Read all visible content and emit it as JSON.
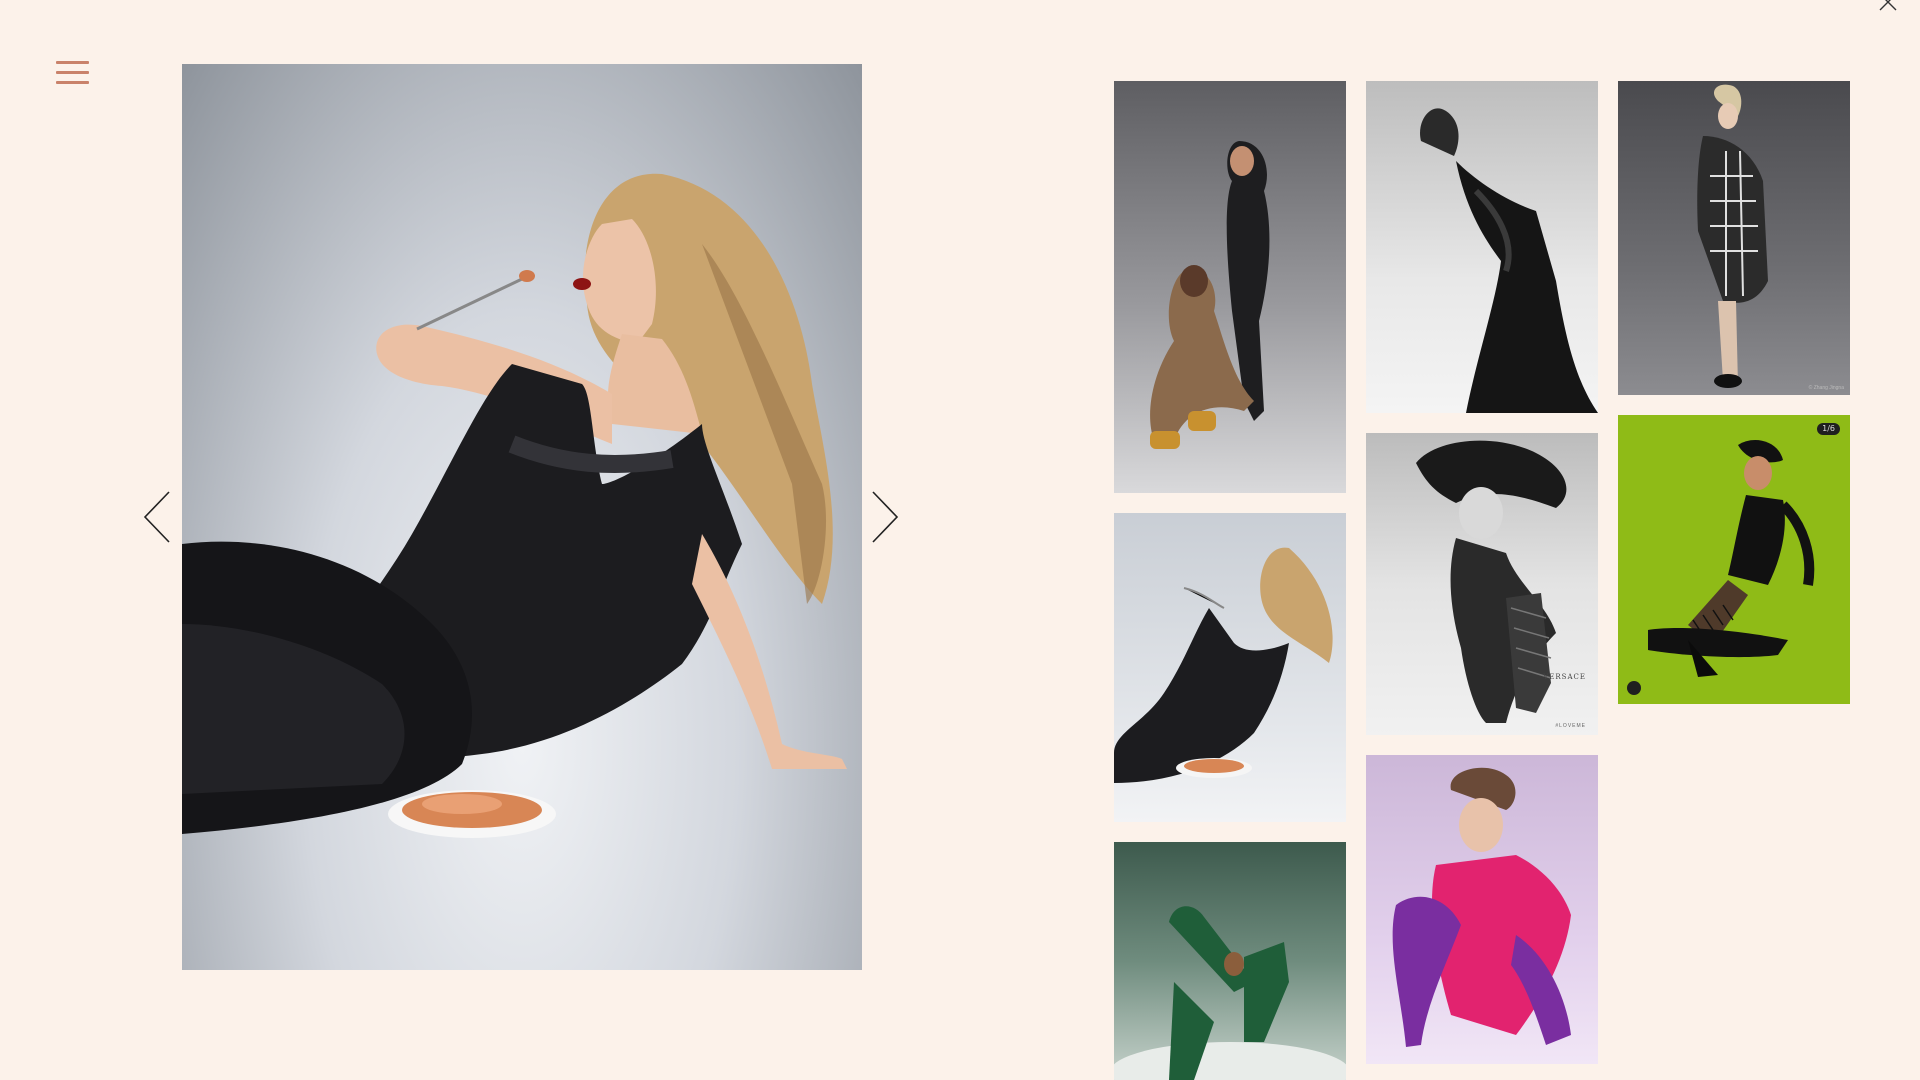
{
  "menu": {
    "icon": "hamburger-menu-icon",
    "color": "#c9826a"
  },
  "close": {
    "icon": "close-icon"
  },
  "lightbox": {
    "current_photo": "Blonde model in black dress eating pasta",
    "prev_icon": "chevron-left-icon",
    "next_icon": "chevron-right-icon"
  },
  "gallery": {
    "thumbnails": [
      {
        "subject": "Two models in black and brown outfits"
      },
      {
        "subject": "Blonde model eating pasta"
      },
      {
        "subject": "Model in green tights on floor"
      },
      {
        "subject": "Black and white portrait, head tilted back"
      },
      {
        "subject": "Black and white model in fishnet boots"
      },
      {
        "subject": "Model in pink blazer and purple tights"
      },
      {
        "subject": "Model in checkered coat"
      },
      {
        "subject": "Model in fishnets on green background"
      }
    ],
    "t5_text": "VERSACE",
    "t5_tag": "#LOVEME",
    "t7_credit": "© Zhang Jingna",
    "t8_count": "1/6"
  },
  "colors": {
    "background": "#fcf2ea",
    "accent": "#c9826a",
    "lime": "#8fbb17"
  }
}
